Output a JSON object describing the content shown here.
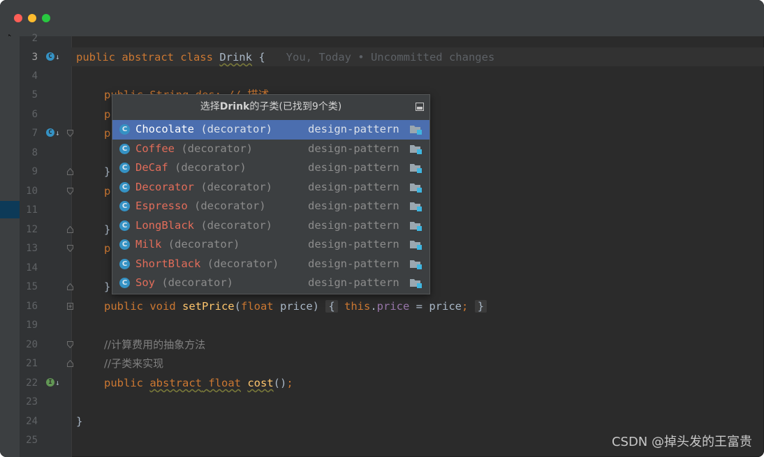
{
  "editor": {
    "lines": [
      {
        "n": "2"
      },
      {
        "n": "3",
        "current": true,
        "icon": "override",
        "code_prefix": "public abstract class ",
        "class_name": "Drink",
        "code_suffix": " {",
        "inlay": "You, Today • Uncommitted changes"
      },
      {
        "n": "4"
      },
      {
        "n": "5",
        "hidden_code": "public String des; // 描述"
      },
      {
        "n": "6",
        "hidden_code": "p"
      },
      {
        "n": "7",
        "icon": "override",
        "hidden_code": "p"
      },
      {
        "n": "8"
      },
      {
        "n": "9",
        "hidden_code": "}"
      },
      {
        "n": "10",
        "hidden_code": "p"
      },
      {
        "n": "11"
      },
      {
        "n": "12",
        "hidden_code": "}"
      },
      {
        "n": "13",
        "hidden_code": "p"
      },
      {
        "n": "14"
      },
      {
        "n": "15",
        "hidden_code": "}"
      },
      {
        "n": "16"
      },
      {
        "n": "19"
      },
      {
        "n": "20"
      },
      {
        "n": "21"
      },
      {
        "n": "22",
        "icon": "implemented"
      },
      {
        "n": "23"
      },
      {
        "n": "24"
      },
      {
        "n": "25"
      }
    ],
    "line16": {
      "kw1": "public void ",
      "fn": "setPrice",
      "p1": "(",
      "kw2": "float",
      "p2": " price) ",
      "b1": "{",
      "kw3": " this",
      "dot": ".",
      "field": "price",
      "rest": " = price",
      "semi": ";",
      "b2": "}"
    },
    "line20": "//计算费用的抽象方法",
    "line21": "//子类来实现",
    "line22": {
      "kw": "public ",
      "kw2": "abstract",
      "sp": " ",
      "kw3": "float",
      "sp2": " ",
      "fn": "cost",
      "rest": "()",
      "semi": ";"
    },
    "line24": "}",
    "line5_visible": "publi  String  des; // 描述"
  },
  "popup": {
    "title_pre": "选择",
    "title_bold": "Drink",
    "title_post": "的子类(已找到9个类)",
    "items": [
      {
        "name": "Chocolate",
        "pkg": " (decorator)",
        "module": "design-pattern",
        "selected": true
      },
      {
        "name": "Coffee",
        "pkg": " (decorator)",
        "module": "design-pattern"
      },
      {
        "name": "DeCaf",
        "pkg": " (decorator)",
        "module": "design-pattern"
      },
      {
        "name": "Decorator",
        "pkg": " (decorator)",
        "module": "design-pattern"
      },
      {
        "name": "Espresso",
        "pkg": " (decorator)",
        "module": "design-pattern"
      },
      {
        "name": "LongBlack",
        "pkg": " (decorator)",
        "module": "design-pattern"
      },
      {
        "name": "Milk",
        "pkg": " (decorator)",
        "module": "design-pattern"
      },
      {
        "name": "ShortBlack",
        "pkg": " (decorator)",
        "module": "design-pattern"
      },
      {
        "name": "Soy",
        "pkg": " (decorator)",
        "module": "design-pattern"
      }
    ],
    "class_icon_letter": "C"
  },
  "watermark": "CSDN @掉头发的王富贵",
  "colors": {
    "background": "#2b2b2b",
    "keyword": "#cc7832",
    "function": "#ffc66d",
    "field": "#9876aa",
    "selection": "#4b6eaf",
    "class_name_red": "#e26d5a"
  }
}
